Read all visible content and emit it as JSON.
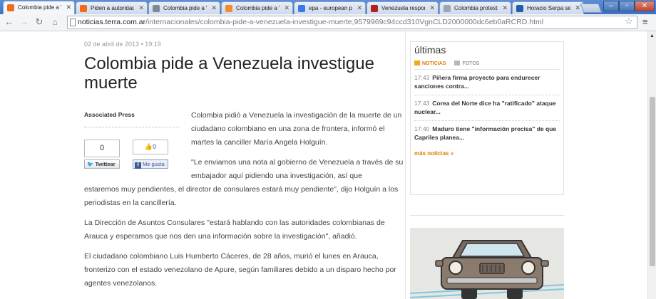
{
  "browser": {
    "tabs": [
      {
        "label": "Colombia pide a Ve",
        "icon": "terra-icon",
        "color": "#f26b1d",
        "active": true
      },
      {
        "label": "Piden a autoridad",
        "icon": "terra-icon",
        "color": "#f26b1d",
        "active": false
      },
      {
        "label": "Colombia pide a Ve",
        "icon": "page-icon",
        "color": "#7a8a9a",
        "active": false
      },
      {
        "label": "Colombia pide a Ve",
        "icon": "bookmark-icon",
        "color": "#f28c28",
        "active": false
      },
      {
        "label": "epa - european pr",
        "icon": "google-icon",
        "color": "#3b78e7",
        "active": false
      },
      {
        "label": "Venezuela respon",
        "icon": "el-tiempo-icon",
        "color": "#b32020",
        "active": false
      },
      {
        "label": "Colombia protesta",
        "icon": "page-icon",
        "color": "#9aa7b5",
        "active": false
      },
      {
        "label": "Horacio Serpa se",
        "icon": "news-icon",
        "color": "#1f5fa8",
        "active": false
      }
    ],
    "url_host": "noticias.terra.com.ar",
    "url_path": "/internacionales/colombia-pide-a-venezuela-investigue-muerte,9579969c94ccd310VgnCLD2000000dc6eb0aRCRD.html"
  },
  "article": {
    "dateline": "02 de abril de 2013 • 19:19",
    "headline": "Colombia pide a Venezuela investigue muerte",
    "agency": "Associated Press",
    "share_count": "0",
    "like_count": "0",
    "tweet_label": "Twittear",
    "fb_label": "Me gusta",
    "p1": "Colombia pidió a Venezuela la investigación de la muerte de un ciudadano colombiano en una zona de frontera, informó el martes la canciller María Angela Holguín.",
    "p2_top": "\"Le enviamos una nota al gobierno de Venezuela a través de su embajador aquí pidiendo una investigación, así que",
    "p2_bottom": "estaremos muy pendientes, el director de consulares estará muy pendiente\", dijo Holguín a los periodistas en la cancillería.",
    "p3": "La Dirección de Asuntos Consulares \"estará hablando con las autoridades colombianas de Arauca y esperamos que nos den una información sobre la investigación\", añadió.",
    "p4": "El ciudadano colombiano Luis Humberto Cáceres, de 28 años, murió el lunes en Arauca, fronterizo con el estado venezolano de Apure, según familiares debido a un disparo hecho por agentes venezolanos."
  },
  "sidebar": {
    "title": "últimas",
    "tab_news": "NOTICIAS",
    "tab_photos": "FOTOS",
    "news": [
      {
        "time": "17:43",
        "text": "Piñera firma proyecto para endurecer sanciones contra..."
      },
      {
        "time": "17:43",
        "text": "Corea del Norte dice ha \"ratificado\" ataque nuclear..."
      },
      {
        "time": "17:40",
        "text": "Maduro tiene \"información precisa\" de que Capriles planea..."
      }
    ],
    "more_link": "más noticias »"
  },
  "colors": {
    "accent": "#e07a00",
    "link_blue": "#3b5998",
    "chrome_blue": "#3d70c4"
  }
}
